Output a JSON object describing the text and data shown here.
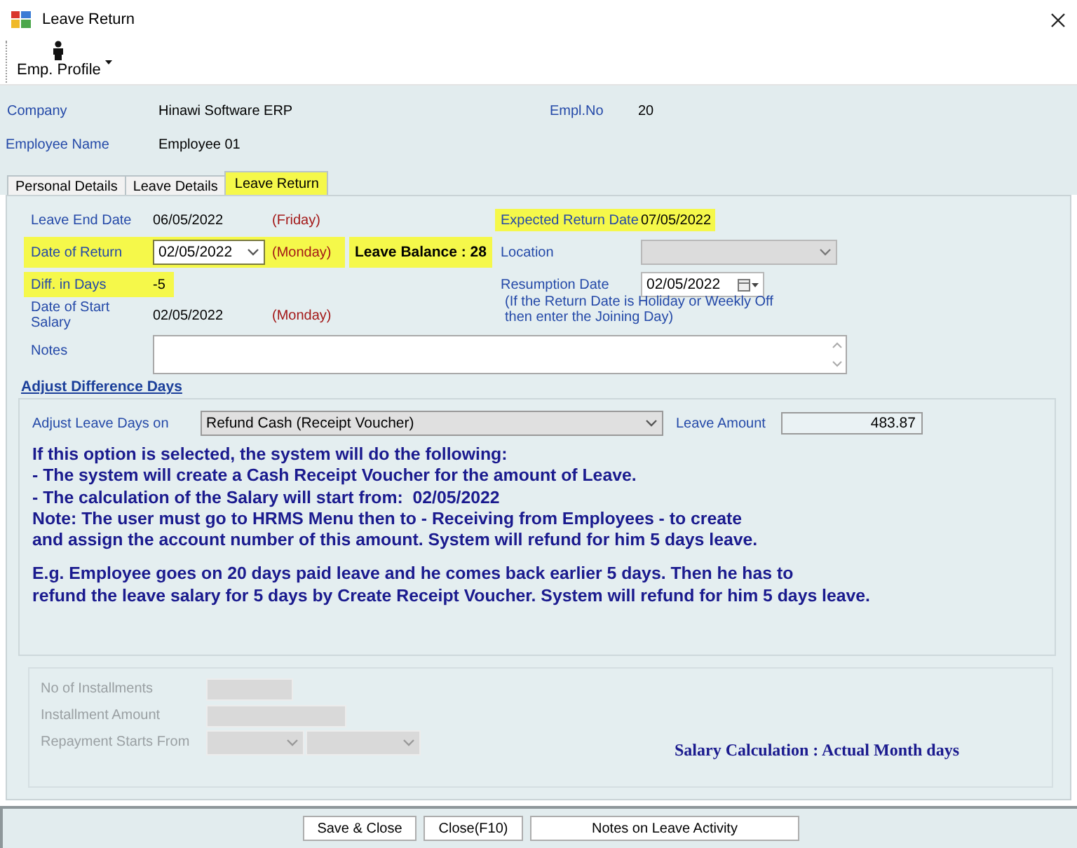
{
  "window": {
    "title": "Leave Return"
  },
  "toolbar": {
    "button": "Emp. Profile"
  },
  "header": {
    "company": {
      "label": "Company",
      "value": "Hinawi Software ERP"
    },
    "empl_no": {
      "label": "Empl.No",
      "value": "20"
    },
    "employee_name": {
      "label": "Employee Name",
      "value": "Employee 01"
    }
  },
  "tabs": [
    {
      "label": "Personal Details",
      "selected": false
    },
    {
      "label": "Leave Details",
      "selected": false
    },
    {
      "label": "Leave Return",
      "selected": true
    }
  ],
  "leave_end_date": {
    "label": "Leave End Date",
    "value": "06/05/2022",
    "day": "(Friday)",
    "highlighted": false
  },
  "expected_return_date": {
    "label": "Expected Return Date",
    "value": "07/05/2022",
    "highlighted": true
  },
  "date_of_return": {
    "label": "Date of Return",
    "value": "02/05/2022",
    "day": "(Monday)",
    "highlighted": true
  },
  "leave_balance": {
    "text": "Leave Balance : 28",
    "highlighted": true
  },
  "location": {
    "label": "Location",
    "disabled": true
  },
  "diff_in_days": {
    "label": "Diff. in Days",
    "value": "-5",
    "highlighted": true
  },
  "resumption_date": {
    "label": "Resumption Date",
    "value": "02/05/2022",
    "hint": "(If the Return Date is Holiday or Weekly Off\nthen enter the Joining Day)"
  },
  "date_of_start_salary": {
    "label": "Date of Start Salary",
    "value": "02/05/2022",
    "day": "(Monday)",
    "highlighted": false
  },
  "notes": {
    "label": "Notes"
  },
  "adjust": {
    "heading": "Adjust Difference Days",
    "label": "Adjust Leave Days on",
    "option": "Refund Cash (Receipt Voucher)",
    "amount_label": "Leave Amount",
    "amount": "483.87"
  },
  "explanation": [
    "If this option is selected, the system will do the following:\n- The system will create a Cash Receipt Voucher for the amount of Leave.\n- The calculation of the Salary will start from:  02/05/2022\nNote: The user must go to HRMS Menu then to - Receiving from Employees - to create\nand assign the account number of this amount. System will refund for him 5 days leave.",
    "E.g. Employee goes on 20 days paid leave and he comes back earlier 5 days. Then he has to\nrefund the leave salary for 5 days by Create Receipt Voucher. System will refund for him 5 days leave."
  ],
  "installments": {
    "disabled": true,
    "fields": [
      {
        "label": "No of Installments",
        "kind": "short"
      },
      {
        "label": "Installment Amount",
        "kind": "long"
      },
      {
        "label": "Repayment Starts From",
        "kind": "dropdowns"
      }
    ]
  },
  "salary_calculation": "Salary Calculation : Actual Month days",
  "buttons": [
    "Save & Close",
    "Close(F10)",
    "Notes on Leave Activity"
  ]
}
